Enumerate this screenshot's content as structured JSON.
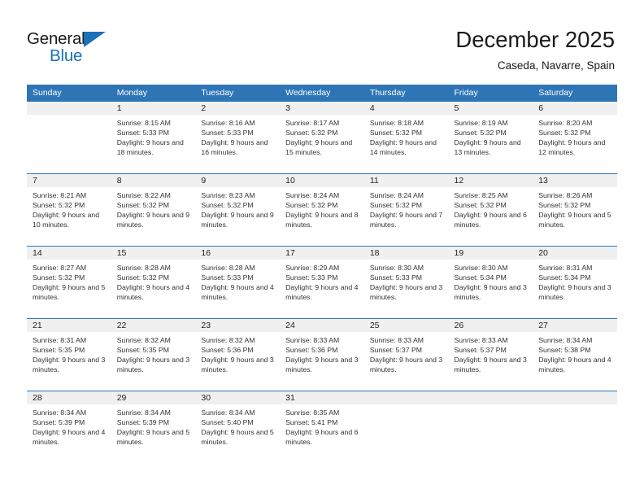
{
  "brand": {
    "name_top": "General",
    "name_bottom": "Blue",
    "logo_icon": "triangle-logo-icon",
    "accent_color": "#1a72b8"
  },
  "header": {
    "title": "December 2025",
    "subtitle": "Caseda, Navarre, Spain"
  },
  "theme": {
    "header_blue": "#2e75b6",
    "day_band_gray": "#f0f0f0",
    "text": "#222222"
  },
  "weekdays": [
    "Sunday",
    "Monday",
    "Tuesday",
    "Wednesday",
    "Thursday",
    "Friday",
    "Saturday"
  ],
  "weeks": [
    [
      {
        "day": "",
        "sunrise": "",
        "sunset": "",
        "daylight": "",
        "empty": true
      },
      {
        "day": "1",
        "sunrise": "Sunrise: 8:15 AM",
        "sunset": "Sunset: 5:33 PM",
        "daylight": "Daylight: 9 hours and 18 minutes."
      },
      {
        "day": "2",
        "sunrise": "Sunrise: 8:16 AM",
        "sunset": "Sunset: 5:33 PM",
        "daylight": "Daylight: 9 hours and 16 minutes."
      },
      {
        "day": "3",
        "sunrise": "Sunrise: 8:17 AM",
        "sunset": "Sunset: 5:32 PM",
        "daylight": "Daylight: 9 hours and 15 minutes."
      },
      {
        "day": "4",
        "sunrise": "Sunrise: 8:18 AM",
        "sunset": "Sunset: 5:32 PM",
        "daylight": "Daylight: 9 hours and 14 minutes."
      },
      {
        "day": "5",
        "sunrise": "Sunrise: 8:19 AM",
        "sunset": "Sunset: 5:32 PM",
        "daylight": "Daylight: 9 hours and 13 minutes."
      },
      {
        "day": "6",
        "sunrise": "Sunrise: 8:20 AM",
        "sunset": "Sunset: 5:32 PM",
        "daylight": "Daylight: 9 hours and 12 minutes."
      }
    ],
    [
      {
        "day": "7",
        "sunrise": "Sunrise: 8:21 AM",
        "sunset": "Sunset: 5:32 PM",
        "daylight": "Daylight: 9 hours and 10 minutes."
      },
      {
        "day": "8",
        "sunrise": "Sunrise: 8:22 AM",
        "sunset": "Sunset: 5:32 PM",
        "daylight": "Daylight: 9 hours and 9 minutes."
      },
      {
        "day": "9",
        "sunrise": "Sunrise: 8:23 AM",
        "sunset": "Sunset: 5:32 PM",
        "daylight": "Daylight: 9 hours and 9 minutes."
      },
      {
        "day": "10",
        "sunrise": "Sunrise: 8:24 AM",
        "sunset": "Sunset: 5:32 PM",
        "daylight": "Daylight: 9 hours and 8 minutes."
      },
      {
        "day": "11",
        "sunrise": "Sunrise: 8:24 AM",
        "sunset": "Sunset: 5:32 PM",
        "daylight": "Daylight: 9 hours and 7 minutes."
      },
      {
        "day": "12",
        "sunrise": "Sunrise: 8:25 AM",
        "sunset": "Sunset: 5:32 PM",
        "daylight": "Daylight: 9 hours and 6 minutes."
      },
      {
        "day": "13",
        "sunrise": "Sunrise: 8:26 AM",
        "sunset": "Sunset: 5:32 PM",
        "daylight": "Daylight: 9 hours and 5 minutes."
      }
    ],
    [
      {
        "day": "14",
        "sunrise": "Sunrise: 8:27 AM",
        "sunset": "Sunset: 5:32 PM",
        "daylight": "Daylight: 9 hours and 5 minutes."
      },
      {
        "day": "15",
        "sunrise": "Sunrise: 8:28 AM",
        "sunset": "Sunset: 5:32 PM",
        "daylight": "Daylight: 9 hours and 4 minutes."
      },
      {
        "day": "16",
        "sunrise": "Sunrise: 8:28 AM",
        "sunset": "Sunset: 5:33 PM",
        "daylight": "Daylight: 9 hours and 4 minutes."
      },
      {
        "day": "17",
        "sunrise": "Sunrise: 8:29 AM",
        "sunset": "Sunset: 5:33 PM",
        "daylight": "Daylight: 9 hours and 4 minutes."
      },
      {
        "day": "18",
        "sunrise": "Sunrise: 8:30 AM",
        "sunset": "Sunset: 5:33 PM",
        "daylight": "Daylight: 9 hours and 3 minutes."
      },
      {
        "day": "19",
        "sunrise": "Sunrise: 8:30 AM",
        "sunset": "Sunset: 5:34 PM",
        "daylight": "Daylight: 9 hours and 3 minutes."
      },
      {
        "day": "20",
        "sunrise": "Sunrise: 8:31 AM",
        "sunset": "Sunset: 5:34 PM",
        "daylight": "Daylight: 9 hours and 3 minutes."
      }
    ],
    [
      {
        "day": "21",
        "sunrise": "Sunrise: 8:31 AM",
        "sunset": "Sunset: 5:35 PM",
        "daylight": "Daylight: 9 hours and 3 minutes."
      },
      {
        "day": "22",
        "sunrise": "Sunrise: 8:32 AM",
        "sunset": "Sunset: 5:35 PM",
        "daylight": "Daylight: 9 hours and 3 minutes."
      },
      {
        "day": "23",
        "sunrise": "Sunrise: 8:32 AM",
        "sunset": "Sunset: 5:36 PM",
        "daylight": "Daylight: 9 hours and 3 minutes."
      },
      {
        "day": "24",
        "sunrise": "Sunrise: 8:33 AM",
        "sunset": "Sunset: 5:36 PM",
        "daylight": "Daylight: 9 hours and 3 minutes."
      },
      {
        "day": "25",
        "sunrise": "Sunrise: 8:33 AM",
        "sunset": "Sunset: 5:37 PM",
        "daylight": "Daylight: 9 hours and 3 minutes."
      },
      {
        "day": "26",
        "sunrise": "Sunrise: 8:33 AM",
        "sunset": "Sunset: 5:37 PM",
        "daylight": "Daylight: 9 hours and 3 minutes."
      },
      {
        "day": "27",
        "sunrise": "Sunrise: 8:34 AM",
        "sunset": "Sunset: 5:38 PM",
        "daylight": "Daylight: 9 hours and 4 minutes."
      }
    ],
    [
      {
        "day": "28",
        "sunrise": "Sunrise: 8:34 AM",
        "sunset": "Sunset: 5:39 PM",
        "daylight": "Daylight: 9 hours and 4 minutes."
      },
      {
        "day": "29",
        "sunrise": "Sunrise: 8:34 AM",
        "sunset": "Sunset: 5:39 PM",
        "daylight": "Daylight: 9 hours and 5 minutes."
      },
      {
        "day": "30",
        "sunrise": "Sunrise: 8:34 AM",
        "sunset": "Sunset: 5:40 PM",
        "daylight": "Daylight: 9 hours and 5 minutes."
      },
      {
        "day": "31",
        "sunrise": "Sunrise: 8:35 AM",
        "sunset": "Sunset: 5:41 PM",
        "daylight": "Daylight: 9 hours and 6 minutes."
      },
      {
        "day": "",
        "sunrise": "",
        "sunset": "",
        "daylight": "",
        "empty": true
      },
      {
        "day": "",
        "sunrise": "",
        "sunset": "",
        "daylight": "",
        "empty": true
      },
      {
        "day": "",
        "sunrise": "",
        "sunset": "",
        "daylight": "",
        "empty": true
      }
    ]
  ]
}
